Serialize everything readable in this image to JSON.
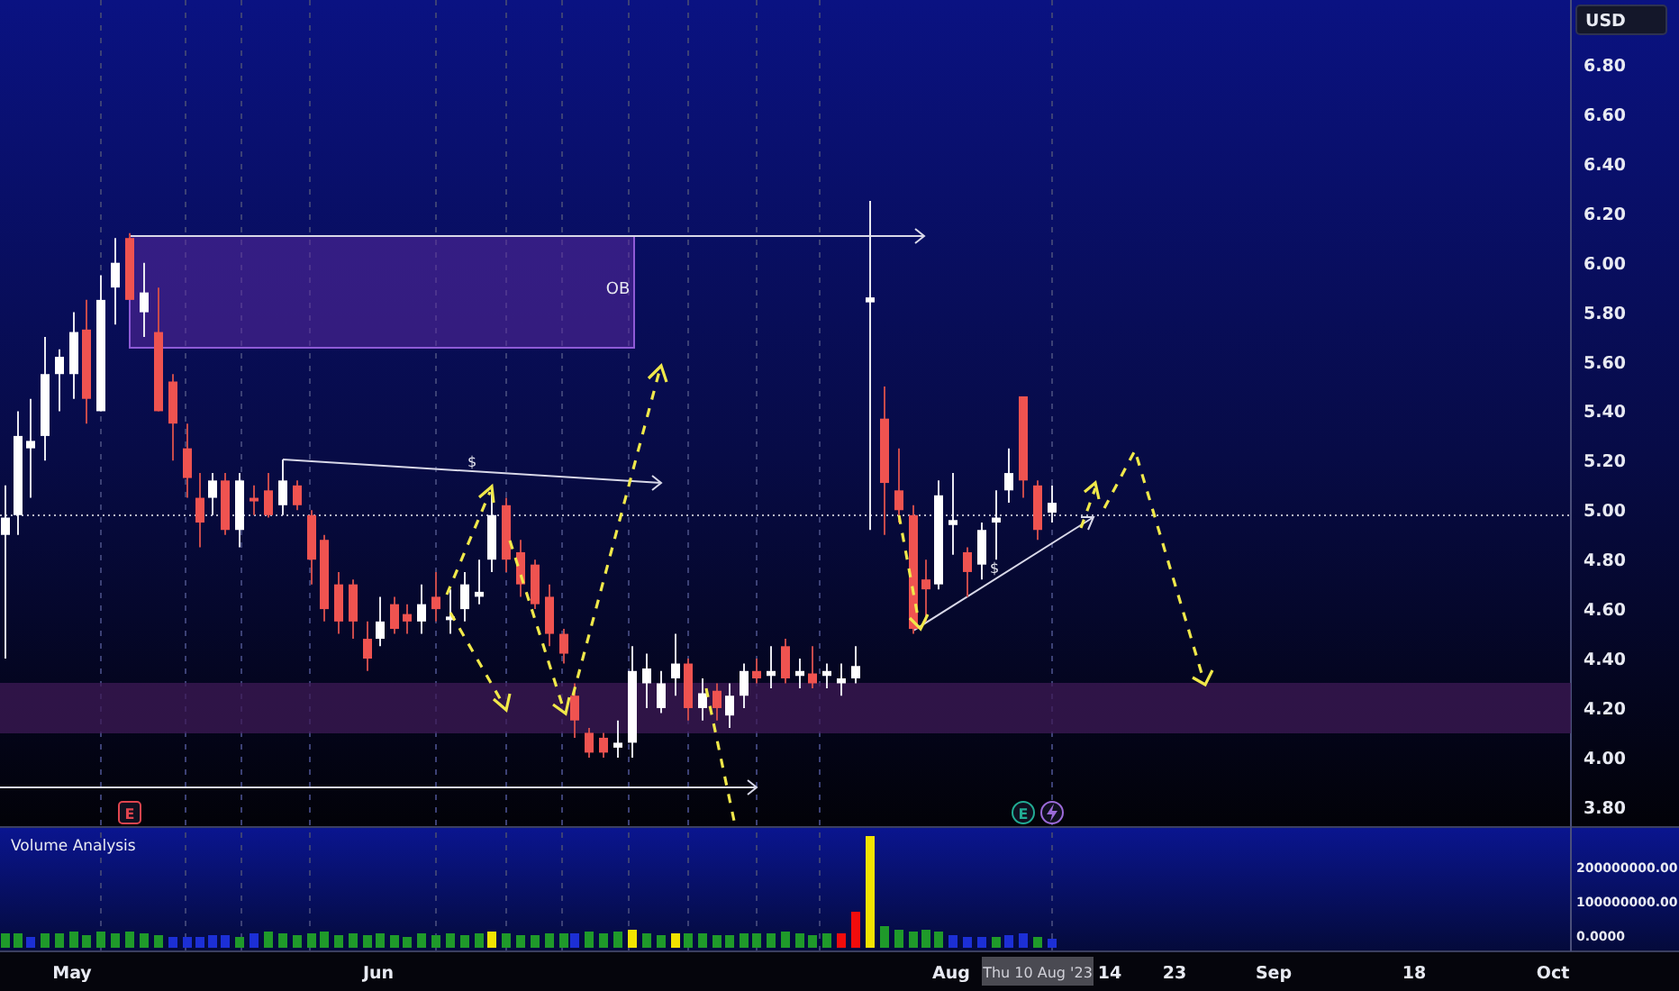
{
  "price_axis": {
    "currency": "USD",
    "ticks": [
      "6.80",
      "6.60",
      "6.40",
      "6.20",
      "6.00",
      "5.80",
      "5.60",
      "5.40",
      "5.20",
      "5.00",
      "4.80",
      "4.60",
      "4.40",
      "4.20",
      "4.00",
      "3.80"
    ]
  },
  "chart": {
    "annotations": [
      {
        "kind": "zone-label",
        "text": "OB"
      },
      {
        "kind": "level-label",
        "text": "$"
      },
      {
        "kind": "level-label",
        "text": "$"
      }
    ],
    "events": [
      {
        "label": "E",
        "color": "#e0454f"
      },
      {
        "label": "E",
        "color": "#22ab94"
      }
    ]
  },
  "volume_pane": {
    "title": "Volume Analysis",
    "ticks": [
      "200000000.00",
      "100000000.00",
      "0.0000"
    ]
  },
  "time_axis": {
    "labels": [
      "May",
      "Jun",
      "Aug",
      "14",
      "23",
      "Sep",
      "18",
      "Oct"
    ],
    "crosshair_label": "Thu 10 Aug '23"
  }
}
